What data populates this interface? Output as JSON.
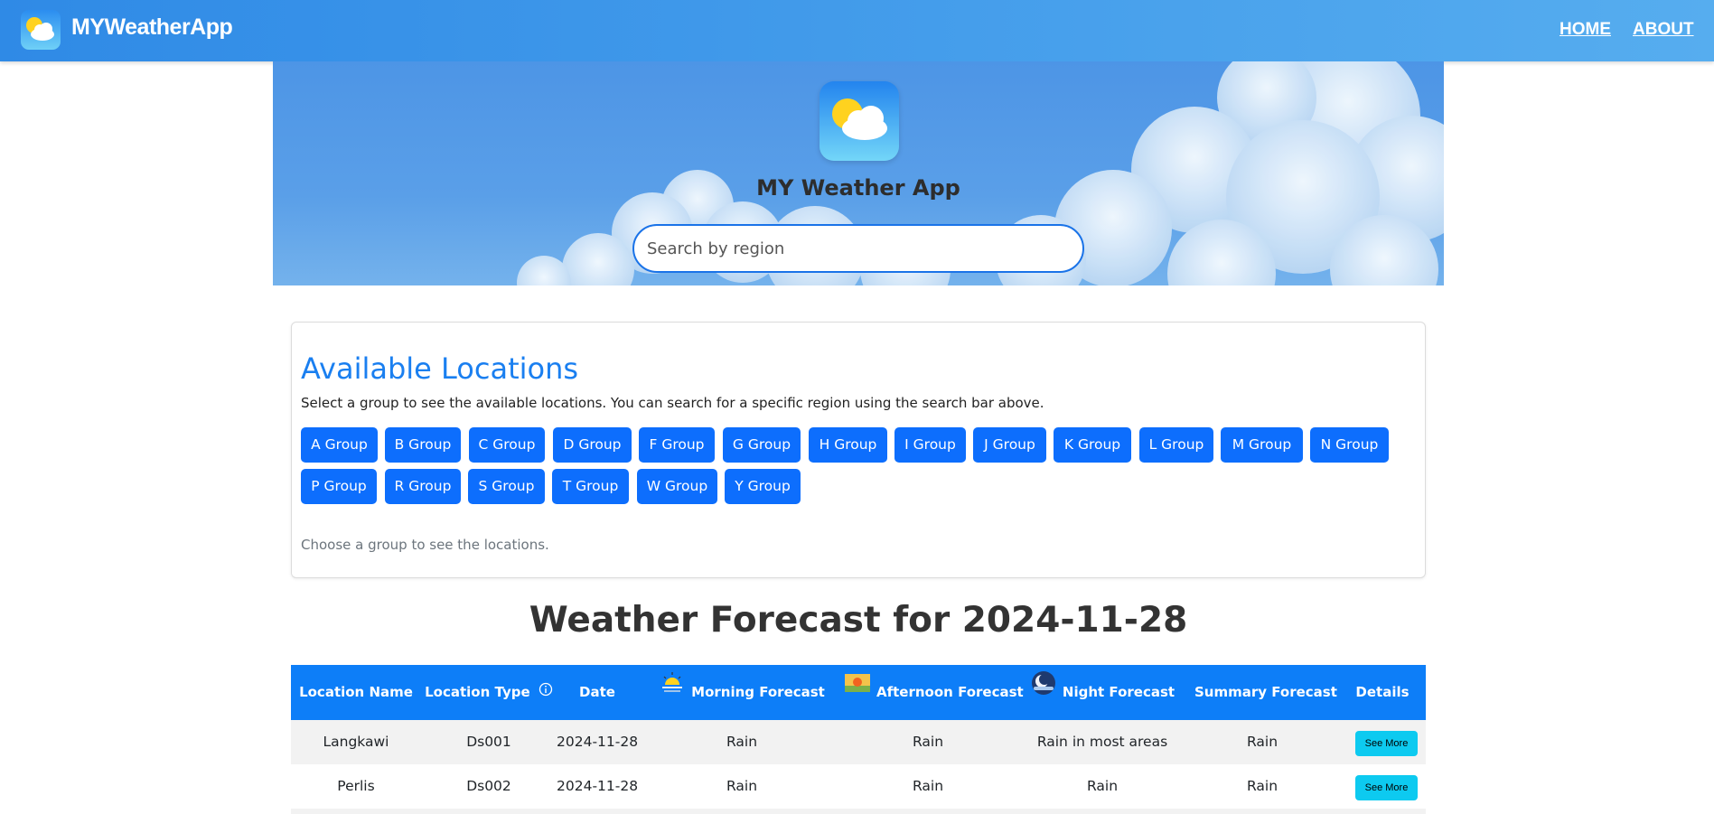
{
  "navbar": {
    "brand": "MYWeatherApp",
    "brand_icon": "partly-cloudy-icon",
    "links": [
      "HOME",
      "ABOUT"
    ],
    "colors": {
      "gradient_start": "#2f8ae6",
      "gradient_end": "#56adef"
    }
  },
  "hero": {
    "title": "MY Weather App",
    "logo_icon": "partly-cloudy-icon",
    "search_placeholder": "Search by region"
  },
  "locations": {
    "title": "Available Locations",
    "description": "Select a group to see the available locations. You can search for a specific region using the search bar above.",
    "groups": [
      "A Group",
      "B Group",
      "C Group",
      "D Group",
      "F Group",
      "G Group",
      "H Group",
      "I Group",
      "J Group",
      "K Group",
      "L Group",
      "M Group",
      "N Group",
      "P Group",
      "R Group",
      "S Group",
      "T Group",
      "W Group",
      "Y Group"
    ],
    "hint": "Choose a group to see the locations."
  },
  "forecast": {
    "title": "Weather Forecast for 2024-11-28",
    "columns": [
      "Location Name",
      "Location Type",
      "Date",
      "Morning Forecast",
      "Afternoon Forecast",
      "Night Forecast",
      "Summary Forecast",
      "Details"
    ],
    "column_icons": {
      "location_type": "info-icon",
      "morning": "sunrise-icon",
      "afternoon": "afternoon-sun-icon",
      "night": "night-moon-icon"
    },
    "rows": [
      {
        "location": "Langkawi",
        "type": "Ds001",
        "date": "2024-11-28",
        "morning": "Rain",
        "afternoon": "Rain",
        "night": "Rain in most areas",
        "summary": "Rain",
        "details": "See More"
      },
      {
        "location": "Perlis",
        "type": "Ds002",
        "date": "2024-11-28",
        "morning": "Rain",
        "afternoon": "Rain",
        "night": "Rain",
        "summary": "Rain",
        "details": "See More"
      }
    ],
    "colors": {
      "header": "#0d7ef8",
      "button": "#0d6efd",
      "details_button": "#0dcaf0"
    }
  }
}
